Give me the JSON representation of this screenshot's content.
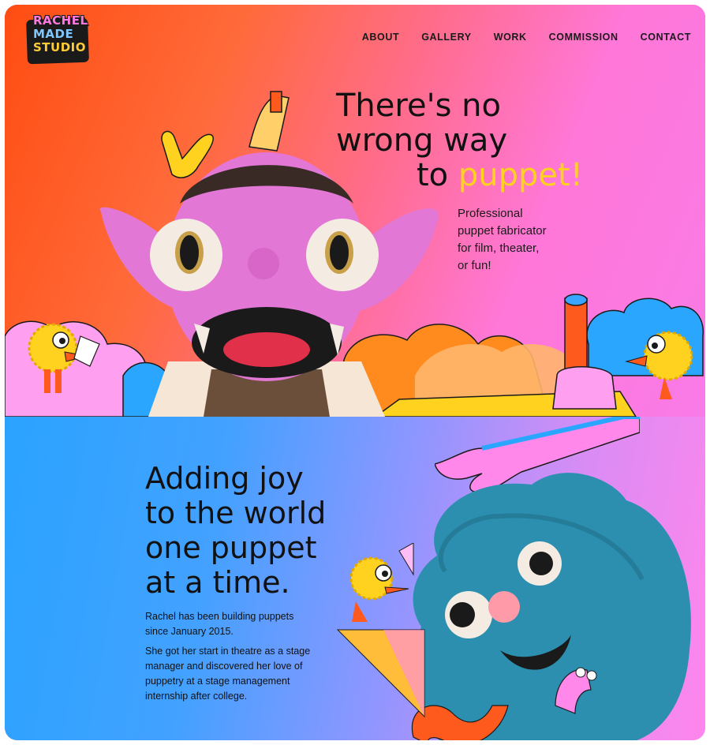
{
  "brand": {
    "logo_lines": [
      "RACHEL",
      "MADE",
      "STUDIO"
    ]
  },
  "nav": {
    "items": [
      "ABOUT",
      "GALLERY",
      "WORK",
      "COMMISSION",
      "CONTACT"
    ]
  },
  "hero": {
    "headline_line1": "There's no",
    "headline_line2": "wrong way",
    "headline_line3_prefix": "to ",
    "headline_line3_accent": "puppet!",
    "tagline_lines": [
      "Professional",
      "puppet fabricator",
      "for film, theater,",
      "or fun!"
    ]
  },
  "about": {
    "title_lines": [
      "Adding joy",
      "to the world",
      "one puppet",
      "at a time."
    ],
    "paragraph1": "Rachel has been building puppets since January 2015.",
    "paragraph2": "She got her start in theatre as a stage manager and discovered her love of puppetry at a stage management internship after college."
  },
  "colors": {
    "accent_yellow": "#ffd21f",
    "hero_orange": "#ff4d12",
    "hero_pink": "#ff77d8",
    "about_blue": "#2aa3ff",
    "puppet_pink": "#e277d6",
    "puppet_blue": "#2c8fb0"
  },
  "icons": [
    "pink-puppet-illustration",
    "blue-puppet-illustration",
    "yellow-bird-icon",
    "cloud-icon",
    "hand-icon"
  ]
}
